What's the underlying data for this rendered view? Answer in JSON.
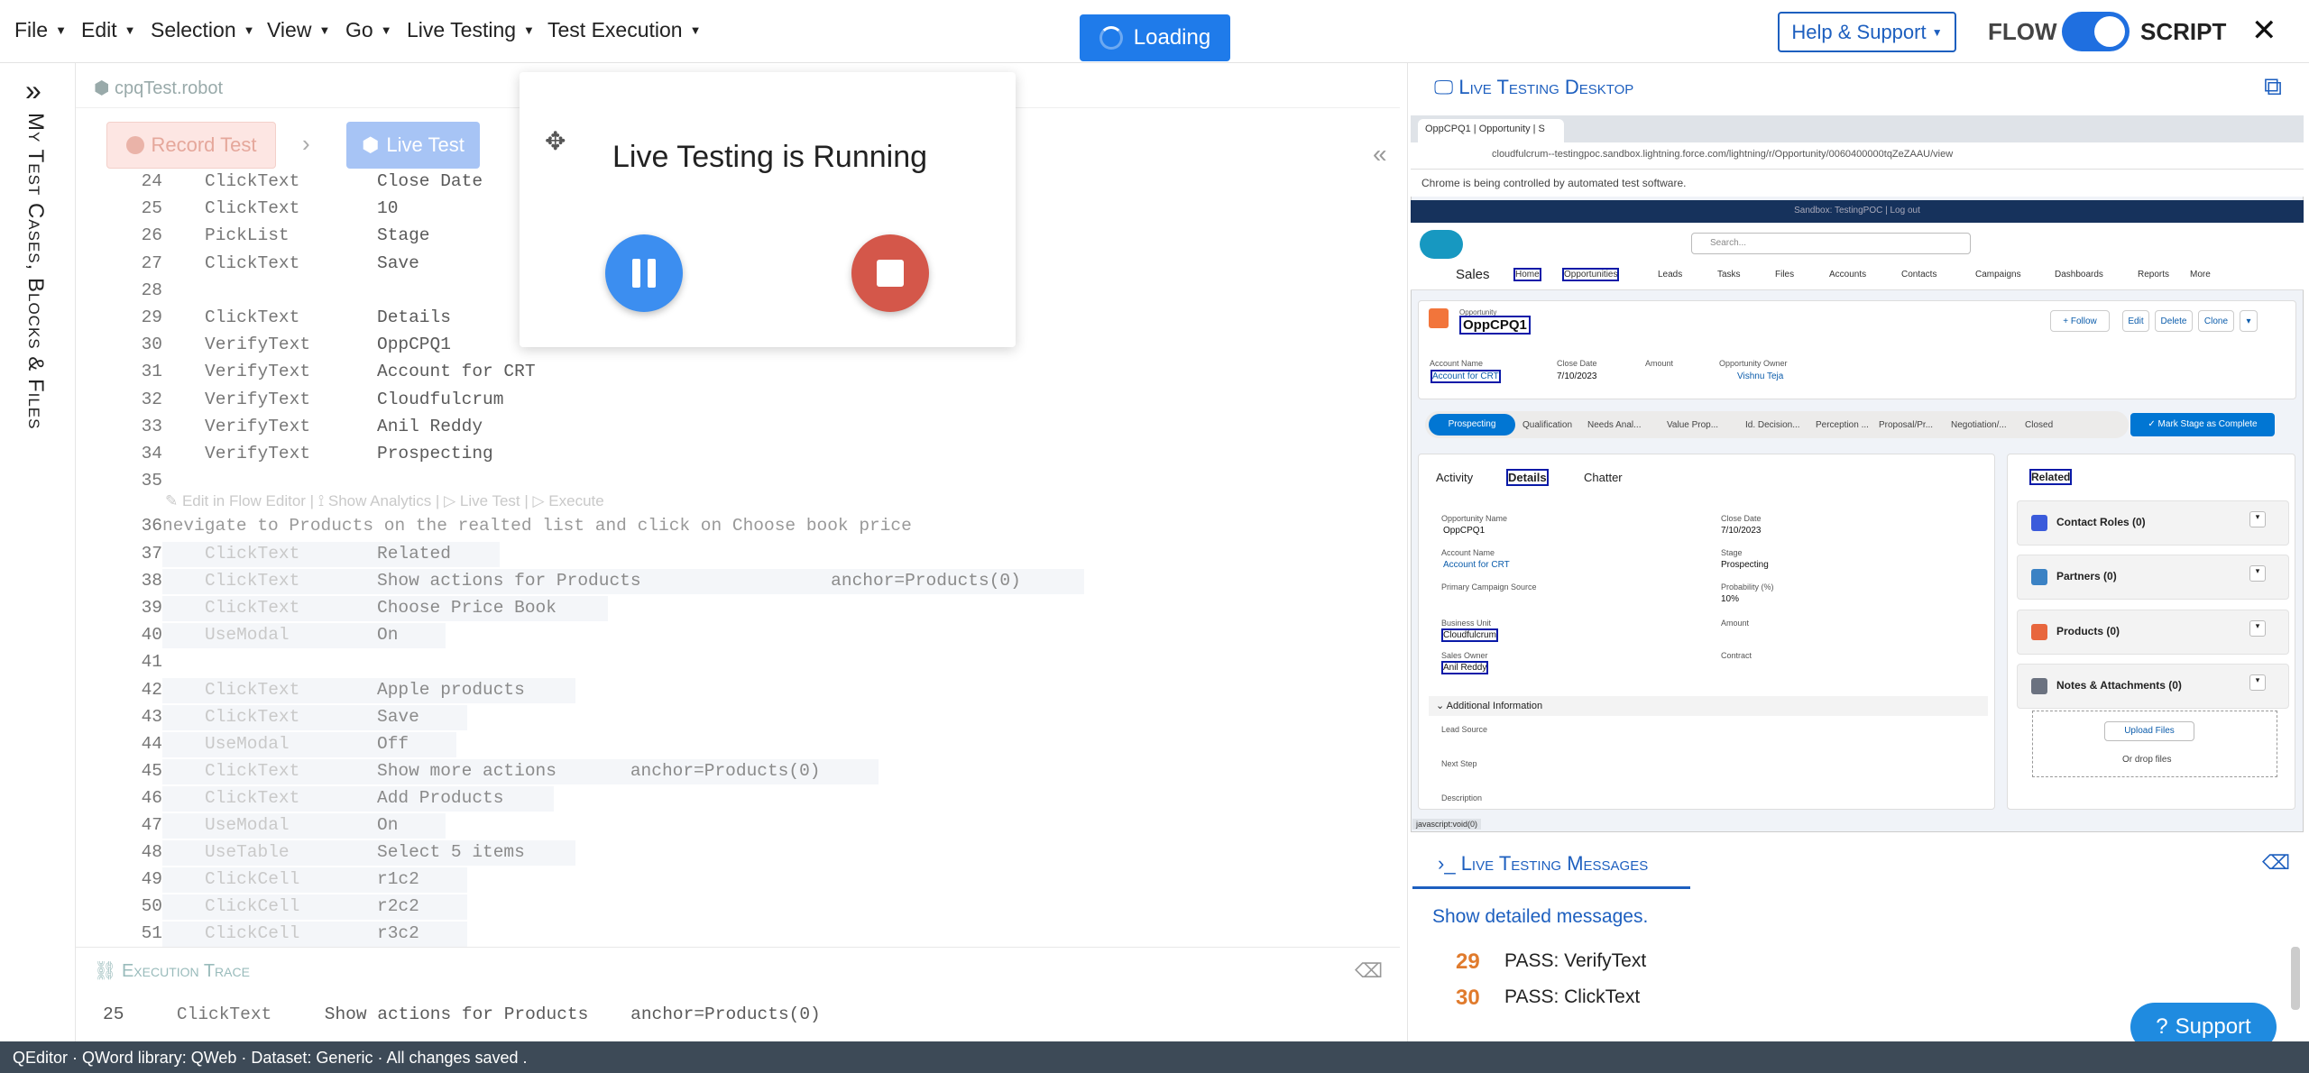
{
  "menu": [
    "File",
    "Edit",
    "Selection",
    "View",
    "Go",
    "Live Testing",
    "Test Execution"
  ],
  "loading_label": "Loading",
  "help_label": "Help & Support",
  "flow_label": "FLOW",
  "script_label": "SCRIPT",
  "sidebar_title": "My Test Cases, Blocks & Files",
  "file_tab": "cpqTest.robot",
  "record_label": "Record Test",
  "live_test_label": "Live Test",
  "overlay_title": "Live Testing is Running",
  "code_lines": [
    {
      "n": "24",
      "kw": "ClickText",
      "arg": "Close Date"
    },
    {
      "n": "25",
      "kw": "ClickText",
      "arg": "10"
    },
    {
      "n": "26",
      "kw": "PickList",
      "arg": "Stage"
    },
    {
      "n": "27",
      "kw": "ClickText",
      "arg": "Save"
    },
    {
      "n": "28",
      "kw": "",
      "arg": ""
    },
    {
      "n": "29",
      "kw": "ClickText",
      "arg": "Details"
    },
    {
      "n": "30",
      "kw": "VerifyText",
      "arg": "OppCPQ1"
    },
    {
      "n": "31",
      "kw": "VerifyText",
      "arg": "Account for CRT"
    },
    {
      "n": "32",
      "kw": "VerifyText",
      "arg": "Cloudfulcrum"
    },
    {
      "n": "33",
      "kw": "VerifyText",
      "arg": "Anil Reddy"
    },
    {
      "n": "34",
      "kw": "VerifyText",
      "arg": "Prospecting"
    },
    {
      "n": "35",
      "kw": "",
      "arg": ""
    }
  ],
  "hint_line": "✎ Edit in Flow Editor | ⟟ Show Analytics | ▷ Live Test | ▷ Execute",
  "line36": {
    "n": "36",
    "text": "nevigate to Products on the realted list and click on Choose book price"
  },
  "code_lines2": [
    {
      "n": "37",
      "kw": "ClickText",
      "arg": "Related"
    },
    {
      "n": "38",
      "kw": "ClickText",
      "arg": "Show actions for Products                  anchor=Products(0)"
    },
    {
      "n": "39",
      "kw": "ClickText",
      "arg": "Choose Price Book"
    },
    {
      "n": "40",
      "kw": "UseModal",
      "arg": "On"
    },
    {
      "n": "41",
      "kw": "",
      "arg": ""
    },
    {
      "n": "42",
      "kw": "ClickText",
      "arg": "Apple products"
    },
    {
      "n": "43",
      "kw": "ClickText",
      "arg": "Save"
    },
    {
      "n": "44",
      "kw": "UseModal",
      "arg": "Off"
    },
    {
      "n": "45",
      "kw": "ClickText",
      "arg": "Show more actions       anchor=Products(0)"
    },
    {
      "n": "46",
      "kw": "ClickText",
      "arg": "Add Products"
    },
    {
      "n": "47",
      "kw": "UseModal",
      "arg": "On"
    },
    {
      "n": "48",
      "kw": "UseTable",
      "arg": "Select 5 items"
    },
    {
      "n": "49",
      "kw": "ClickCell",
      "arg": "r1c2"
    },
    {
      "n": "50",
      "kw": "ClickCell",
      "arg": "r2c2"
    },
    {
      "n": "51",
      "kw": "ClickCell",
      "arg": "r3c2"
    }
  ],
  "trace_title": "Execution Trace",
  "trace_line": {
    "n": "25",
    "kw": "ClickText",
    "arg": "Show actions for Products    anchor=Products(0)"
  },
  "right_title": "Live Testing Desktop",
  "browser": {
    "tab": "OppCPQ1 | Opportunity | S",
    "url": "cloudfulcrum--testingpoc.sandbox.lightning.force.com/lightning/r/Opportunity/0060400000tqZeZAAU/view",
    "automation": "Chrome is being controlled by automated test software.",
    "sandbox": "Sandbox: TestingPOC | Log out",
    "search": "Search...",
    "app": "Sales",
    "nav": [
      "Home",
      "Opportunities",
      "Leads",
      "Tasks",
      "Files",
      "Accounts",
      "Contacts",
      "Campaigns",
      "Dashboards",
      "Reports",
      "More"
    ],
    "record_label": "Opportunity",
    "record_name": "OppCPQ1",
    "buttons": [
      "+ Follow",
      "Edit",
      "Delete",
      "Clone"
    ],
    "highlights": [
      {
        "label": "Account Name",
        "value": "Account for CRT"
      },
      {
        "label": "Close Date",
        "value": "7/10/2023"
      },
      {
        "label": "Amount",
        "value": ""
      },
      {
        "label": "Opportunity Owner",
        "value": "Vishnu Teja"
      }
    ],
    "path": [
      "Prospecting",
      "Qualification",
      "Needs Anal...",
      "Value Prop...",
      "Id. Decision...",
      "Perception ...",
      "Proposal/Pr...",
      "Negotiation/...",
      "Closed"
    ],
    "mark_button": "✓ Mark Stage as Complete",
    "tabs": [
      "Activity",
      "Details",
      "Chatter"
    ],
    "fields_left": [
      {
        "label": "Opportunity Name",
        "value": "OppCPQ1"
      },
      {
        "label": "Account Name",
        "value": "Account for CRT"
      },
      {
        "label": "Primary Campaign Source",
        "value": ""
      },
      {
        "label": "Business Unit",
        "value": "Cloudfulcrum"
      },
      {
        "label": "Sales Owner",
        "value": "Anil Reddy"
      }
    ],
    "fields_right": [
      {
        "label": "Close Date",
        "value": "7/10/2023"
      },
      {
        "label": "Stage",
        "value": "Prospecting"
      },
      {
        "label": "Probability (%)",
        "value": "10%"
      },
      {
        "label": "Amount",
        "value": ""
      },
      {
        "label": "Contract",
        "value": ""
      }
    ],
    "section": "Additional Information",
    "fields_extra": [
      "Lead Source",
      "Next Step",
      "Description"
    ],
    "related_tab": "Related",
    "related": [
      "Contact Roles (0)",
      "Partners (0)",
      "Products (0)",
      "Notes & Attachments (0)"
    ],
    "upload": "Upload Files",
    "drop": "Or drop files",
    "status_link": "javascript:void(0)"
  },
  "messages_title": "Live Testing Messages",
  "show_detailed": "Show detailed messages.",
  "messages": [
    {
      "n": "29",
      "text": "PASS: VerifyText"
    },
    {
      "n": "30",
      "text": "PASS: ClickText"
    }
  ],
  "support_label": "Support",
  "status_bar": "QEditor · QWord library: QWeb · Dataset: Generic · All changes saved ."
}
